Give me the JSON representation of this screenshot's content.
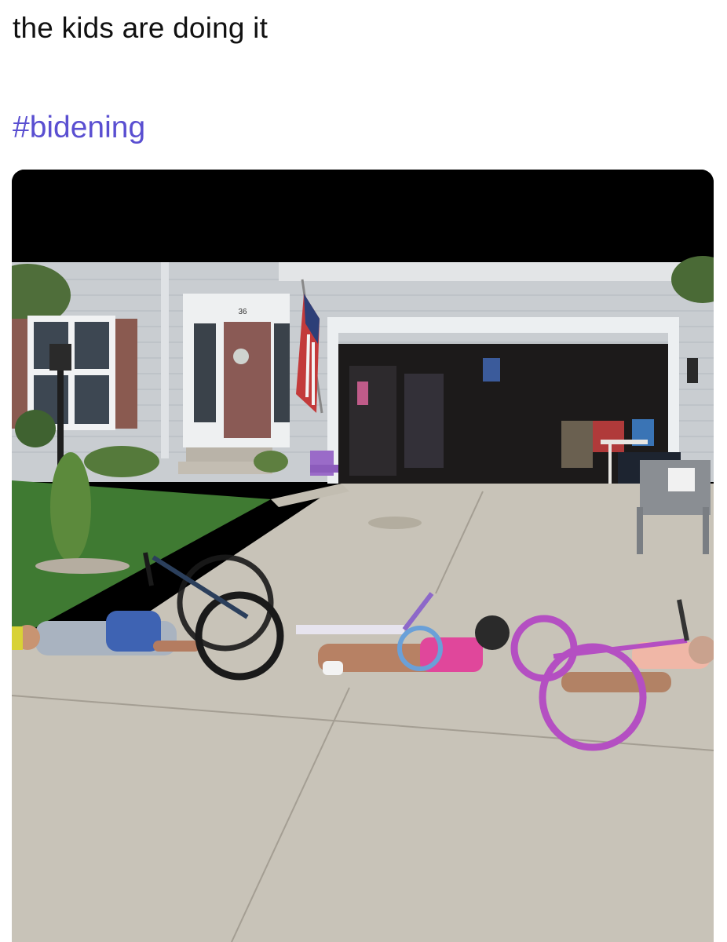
{
  "post": {
    "text": "the kids are doing it",
    "hashtag": "#bidening"
  },
  "photo": {
    "house_number": "36"
  },
  "colors": {
    "hashtag": "#5a4fd1",
    "text": "#111111",
    "background": "#ffffff"
  }
}
